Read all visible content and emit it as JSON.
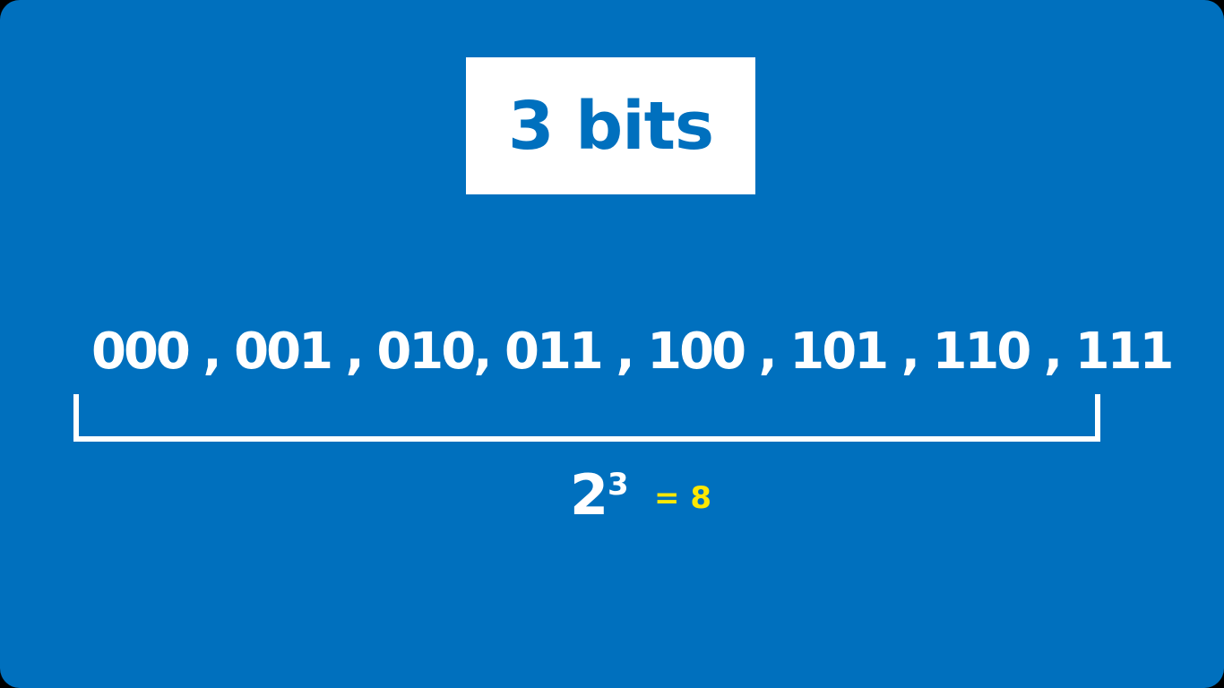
{
  "slide": {
    "title": "3 bits",
    "combinations": "000 , 001 , 010, 011 , 100 , 101 , 110 , 111",
    "formula": {
      "base": "2",
      "exponent": "3",
      "result": "= 8"
    },
    "colors": {
      "background": "#0070BE",
      "title_box": "#FFFFFF",
      "title_text": "#0070BE",
      "text": "#FFFFFF",
      "result": "#FFE800"
    }
  }
}
